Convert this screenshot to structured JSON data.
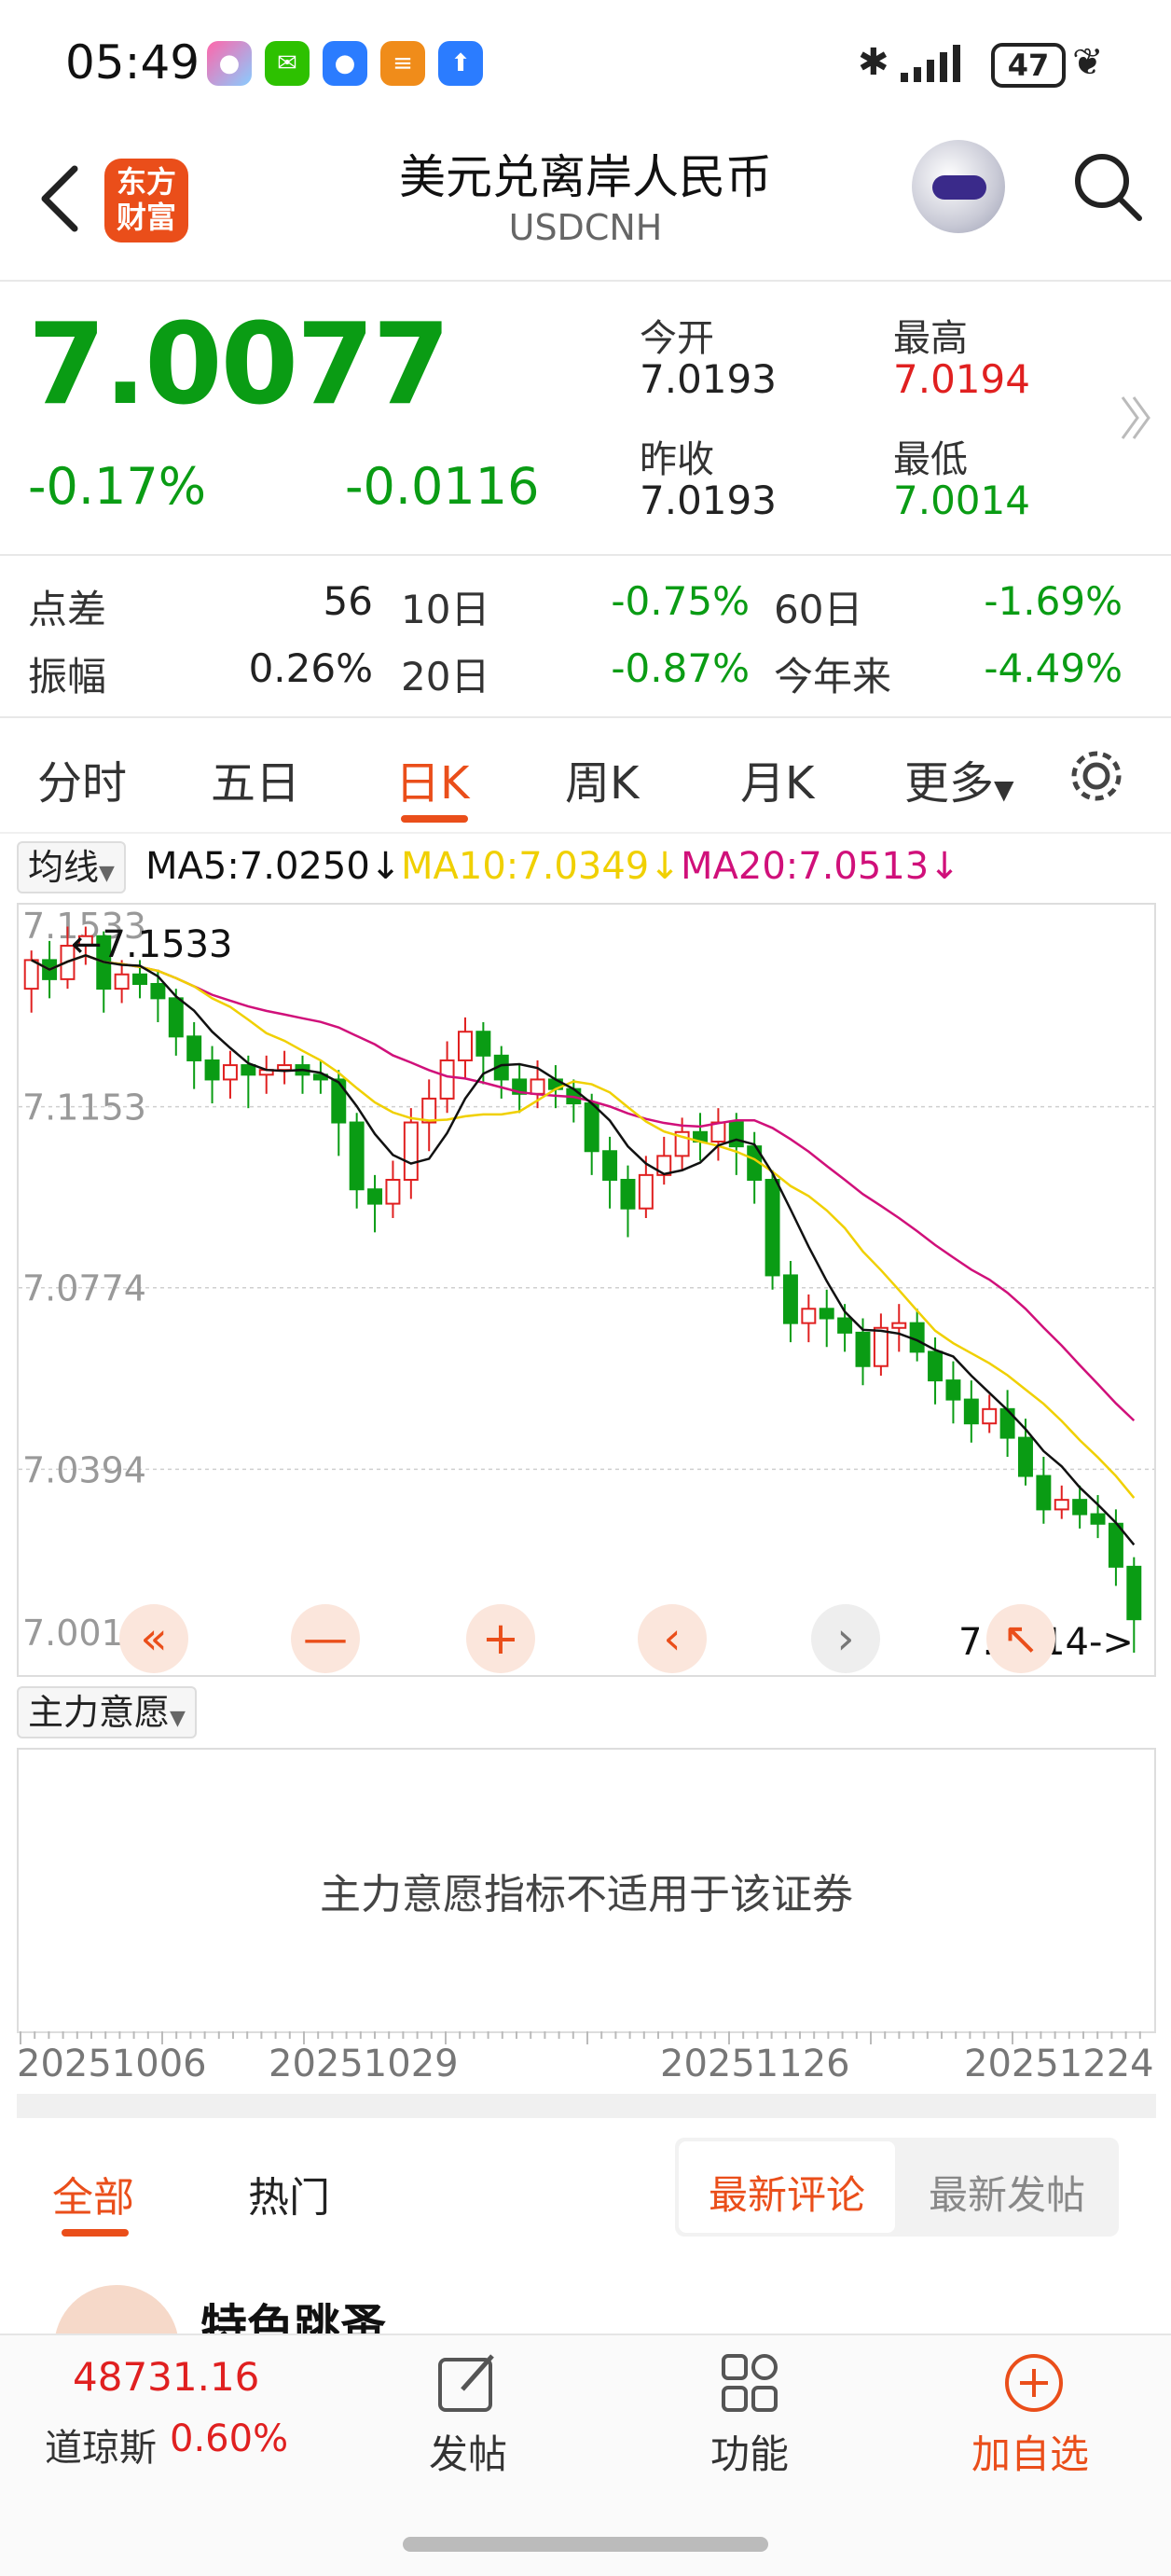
{
  "status_bar": {
    "time": "05:49",
    "battery": "47"
  },
  "header": {
    "title": "美元兑离岸人民币",
    "subtitle": "USDCNH",
    "logo_text_1": "东方",
    "logo_text_2": "财富"
  },
  "quote": {
    "price": "7.0077",
    "change_pct": "-0.17%",
    "change": "-0.0116",
    "open_label": "今开",
    "open": "7.0193",
    "high_label": "最高",
    "high": "7.0194",
    "prev_close_label": "昨收",
    "prev_close": "7.0193",
    "low_label": "最低",
    "low": "7.0014"
  },
  "stats": [
    {
      "label": "点差",
      "value": "56",
      "label2": "10日",
      "value2": "-0.75%",
      "label3": "60日",
      "value3": "-1.69%"
    },
    {
      "label": "振幅",
      "value": "0.26%",
      "label2": "20日",
      "value2": "-0.87%",
      "label3": "今年来",
      "value3": "-4.49%"
    }
  ],
  "tabs": [
    "分时",
    "五日",
    "日K",
    "周K",
    "月K",
    "更多"
  ],
  "active_tab": "日K",
  "ma_legend": {
    "button": "均线",
    "ma5": "MA5:7.0250",
    "ma10": "MA10:7.0349",
    "ma20": "MA20:7.0513"
  },
  "colors": {
    "accent": "#ea4e1a",
    "down": "#0a9c14",
    "up": "#e02020",
    "ma5": "#111111",
    "ma10": "#f0d000",
    "ma20": "#d0107a"
  },
  "chart_data": {
    "type": "candlestick",
    "y_ticks": [
      "7.1533",
      "7.1153",
      "7.0774",
      "7.0394",
      "7.0014"
    ],
    "ylim": [
      7.0014,
      7.1533
    ],
    "max_annotation": "7.1533",
    "min_annotation": "7.0014->",
    "x_ticks": [
      "20251006",
      "20251029",
      "20251126",
      "20251224"
    ],
    "candles": [
      [
        7.14,
        7.146,
        7.135,
        7.148
      ],
      [
        7.146,
        7.142,
        7.138,
        7.15
      ],
      [
        7.142,
        7.149,
        7.14,
        7.153
      ],
      [
        7.149,
        7.151,
        7.145,
        7.153
      ],
      [
        7.151,
        7.14,
        7.135,
        7.152
      ],
      [
        7.14,
        7.143,
        7.137,
        7.146
      ],
      [
        7.143,
        7.141,
        7.138,
        7.146
      ],
      [
        7.141,
        7.138,
        7.133,
        7.144
      ],
      [
        7.138,
        7.13,
        7.126,
        7.14
      ],
      [
        7.13,
        7.125,
        7.119,
        7.133
      ],
      [
        7.125,
        7.121,
        7.116,
        7.128
      ],
      [
        7.121,
        7.124,
        7.117,
        7.127
      ],
      [
        7.124,
        7.122,
        7.115,
        7.126
      ],
      [
        7.122,
        7.123,
        7.118,
        7.126
      ],
      [
        7.123,
        7.124,
        7.12,
        7.127
      ],
      [
        7.124,
        7.122,
        7.118,
        7.126
      ],
      [
        7.122,
        7.121,
        7.118,
        7.125
      ],
      [
        7.121,
        7.112,
        7.105,
        7.123
      ],
      [
        7.112,
        7.098,
        7.094,
        7.114
      ],
      [
        7.098,
        7.095,
        7.089,
        7.101
      ],
      [
        7.095,
        7.1,
        7.092,
        7.104
      ],
      [
        7.1,
        7.112,
        7.096,
        7.115
      ],
      [
        7.112,
        7.117,
        7.106,
        7.121
      ],
      [
        7.117,
        7.125,
        7.114,
        7.129
      ],
      [
        7.125,
        7.131,
        7.121,
        7.134
      ],
      [
        7.131,
        7.126,
        7.12,
        7.133
      ],
      [
        7.126,
        7.121,
        7.117,
        7.128
      ],
      [
        7.121,
        7.118,
        7.114,
        7.124
      ],
      [
        7.118,
        7.121,
        7.115,
        7.125
      ],
      [
        7.121,
        7.119,
        7.115,
        7.124
      ],
      [
        7.119,
        7.116,
        7.112,
        7.121
      ],
      [
        7.116,
        7.106,
        7.101,
        7.118
      ],
      [
        7.106,
        7.1,
        7.094,
        7.109
      ],
      [
        7.1,
        7.094,
        7.088,
        7.103
      ],
      [
        7.094,
        7.101,
        7.092,
        7.105
      ],
      [
        7.101,
        7.105,
        7.099,
        7.109
      ],
      [
        7.105,
        7.11,
        7.102,
        7.113
      ],
      [
        7.11,
        7.108,
        7.104,
        7.114
      ],
      [
        7.108,
        7.112,
        7.104,
        7.115
      ],
      [
        7.112,
        7.107,
        7.101,
        7.114
      ],
      [
        7.107,
        7.1,
        7.095,
        7.11
      ],
      [
        7.1,
        7.08,
        7.077,
        7.102
      ],
      [
        7.08,
        7.07,
        7.066,
        7.083
      ],
      [
        7.07,
        7.073,
        7.066,
        7.076
      ],
      [
        7.073,
        7.071,
        7.065,
        7.077
      ],
      [
        7.071,
        7.068,
        7.064,
        7.074
      ],
      [
        7.068,
        7.061,
        7.057,
        7.071
      ],
      [
        7.061,
        7.069,
        7.059,
        7.072
      ],
      [
        7.069,
        7.07,
        7.064,
        7.074
      ],
      [
        7.07,
        7.064,
        7.062,
        7.073
      ],
      [
        7.064,
        7.058,
        7.053,
        7.067
      ],
      [
        7.058,
        7.054,
        7.049,
        7.062
      ],
      [
        7.054,
        7.049,
        7.045,
        7.058
      ],
      [
        7.049,
        7.052,
        7.047,
        7.055
      ],
      [
        7.052,
        7.046,
        7.042,
        7.056
      ],
      [
        7.046,
        7.038,
        7.036,
        7.05
      ],
      [
        7.038,
        7.031,
        7.028,
        7.042
      ],
      [
        7.031,
        7.033,
        7.029,
        7.036
      ],
      [
        7.033,
        7.03,
        7.027,
        7.036
      ],
      [
        7.03,
        7.028,
        7.025,
        7.034
      ],
      [
        7.028,
        7.019,
        7.015,
        7.031
      ],
      [
        7.019,
        7.008,
        7.001,
        7.021
      ]
    ],
    "ma5_end": 7.025,
    "ma10_end": 7.0349,
    "ma20_end": 7.0513
  },
  "chart_controls": [
    "«",
    "—",
    "+",
    "‹",
    "›",
    "↖"
  ],
  "indicator": {
    "button": "主力意愿",
    "message": "主力意愿指标不适用于该证券"
  },
  "comments": {
    "tab_all": "全部",
    "tab_hot": "热门",
    "seg_latest_comment": "最新评论",
    "seg_latest_post": "最新发帖",
    "first_user": "特色跳蚤"
  },
  "bottom": {
    "dow_value": "48731.16",
    "dow_name": "道琼斯",
    "dow_pct": "0.60%",
    "post": "发帖",
    "func": "功能",
    "add": "加自选"
  }
}
